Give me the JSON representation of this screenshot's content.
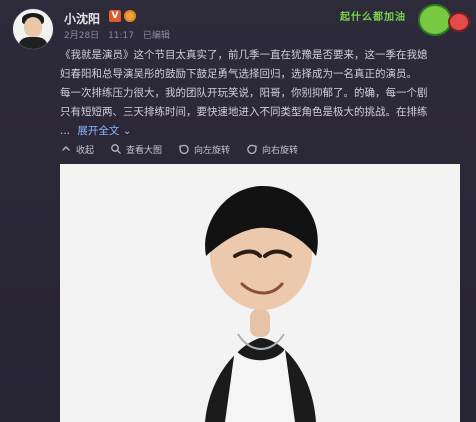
{
  "user": {
    "name": "小沈阳",
    "verified_badge": "V",
    "date": "2月28日",
    "time": "11:17",
    "status": "已编辑"
  },
  "sticker": {
    "text": "起什么都加油"
  },
  "post": {
    "lines": [
      "《我就是演员》这个节目太真实了，前几季一直在犹豫是否要来，这一季在我媳",
      "妇春阳和总导演吴彤的鼓励下鼓足勇气选择回归，选择成为一名真正的演员。",
      "每一次排练压力很大，我的团队开玩笑说，阳哥，你别抑郁了。的确，每一个剧",
      "只有短短两、三天排练时间，要快速地进入不同类型角色是极大的挑战。在排练",
      "..."
    ],
    "expand_label": "展开全文",
    "expand_icon": "chevron-down"
  },
  "actions": {
    "collapse_label": "收起",
    "view_large_label": "查看大图",
    "rotate_left_label": "向左旋转",
    "rotate_right_label": "向右旋转"
  },
  "colors": {
    "background": "#2a2836",
    "text": "#d2cfd8",
    "link": "#8cb6ff",
    "badge_v": "#e35b2c"
  }
}
